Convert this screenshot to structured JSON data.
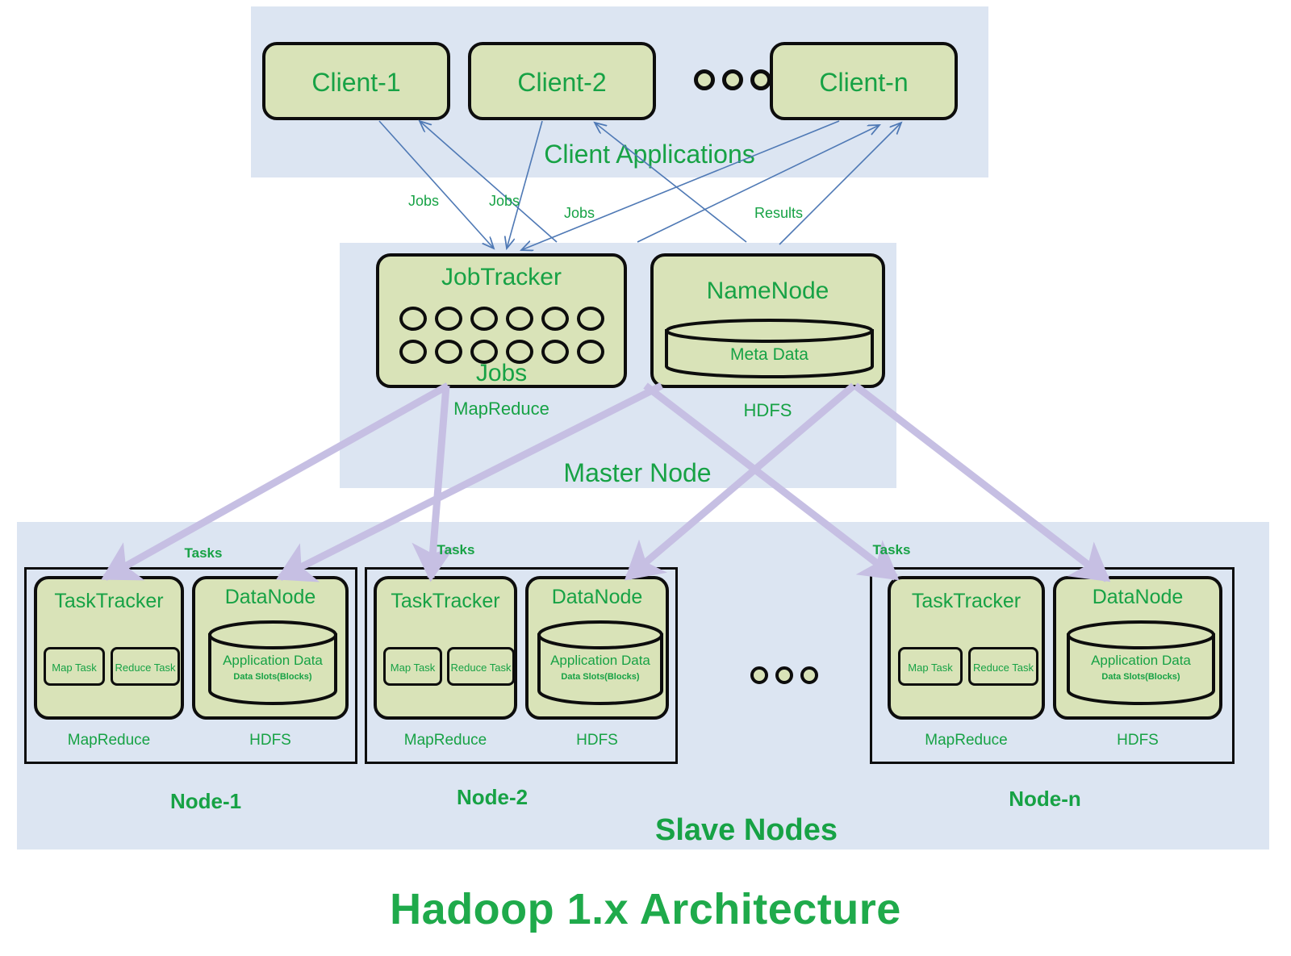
{
  "diagram": {
    "title": "Hadoop 1.x Architecture",
    "accent_green": "#17a245",
    "panel_blue": "#dce5f2",
    "box_green": "#d9e3b8",
    "arrow_blue": "#4f79b5",
    "arrow_purple": "#c6bfe3"
  },
  "client_layer": {
    "caption": "Client Applications",
    "ellipsis": "ooo",
    "clients": [
      {
        "label": "Client-1"
      },
      {
        "label": "Client-2"
      },
      {
        "label": "Client-n"
      }
    ]
  },
  "flows": {
    "jobs_1": "Jobs",
    "jobs_2": "Jobs",
    "jobs_3": "Jobs",
    "results": "Results",
    "tasks_1": "Tasks",
    "tasks_2": "Tasks",
    "tasks_3": "Tasks"
  },
  "master": {
    "caption": "Master Node",
    "jobtracker": {
      "title": "JobTracker",
      "slots_label": "Jobs",
      "slot_count": 12,
      "framework": "MapReduce"
    },
    "namenode": {
      "title": "NameNode",
      "store_label": "Meta Data",
      "framework": "HDFS"
    }
  },
  "slaves": {
    "caption": "Slave Nodes",
    "ellipsis": "ooo",
    "nodes": [
      {
        "name": "Node-1",
        "tasktracker": {
          "title": "TaskTracker",
          "map_task": "Map Task",
          "reduce_task": "Reduce Task",
          "framework": "MapReduce"
        },
        "datanode": {
          "title": "DataNode",
          "store_label": "Application Data",
          "store_sublabel": "Data Slots(Blocks)",
          "framework": "HDFS"
        }
      },
      {
        "name": "Node-2",
        "tasktracker": {
          "title": "TaskTracker",
          "map_task": "Map Task",
          "reduce_task": "Reduce Task",
          "framework": "MapReduce"
        },
        "datanode": {
          "title": "DataNode",
          "store_label": "Application Data",
          "store_sublabel": "Data Slots(Blocks)",
          "framework": "HDFS"
        }
      },
      {
        "name": "Node-n",
        "tasktracker": {
          "title": "TaskTracker",
          "map_task": "Map Task",
          "reduce_task": "Reduce Task",
          "framework": "MapReduce"
        },
        "datanode": {
          "title": "DataNode",
          "store_label": "Application Data",
          "store_sublabel": "Data Slots(Blocks)",
          "framework": "HDFS"
        }
      }
    ]
  }
}
